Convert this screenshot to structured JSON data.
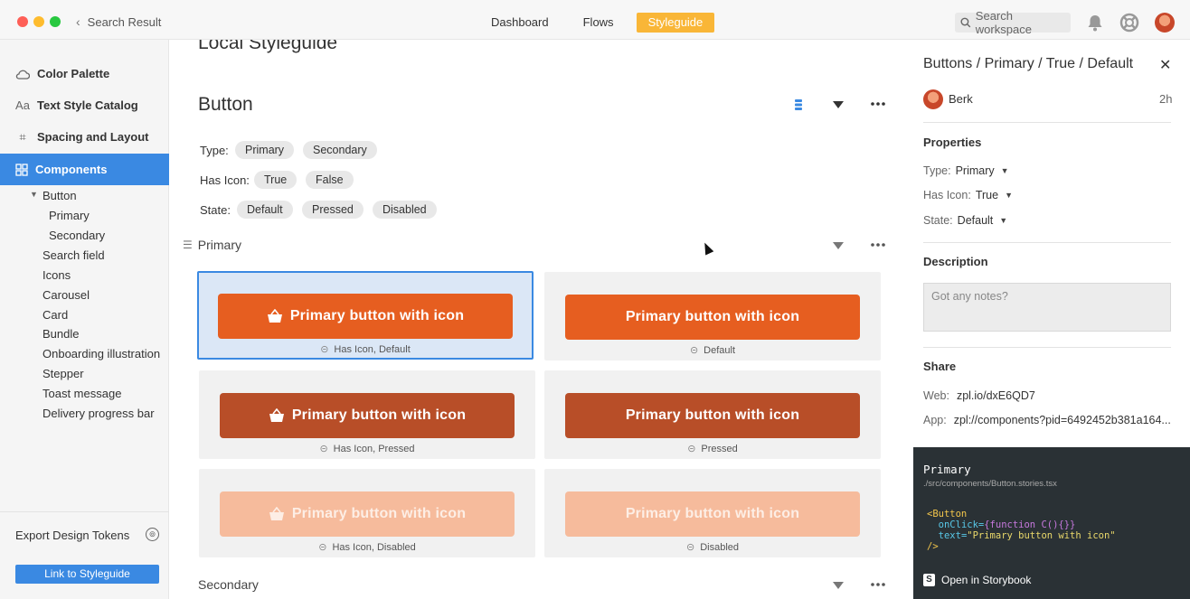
{
  "titlebar": {
    "back_label": "Search Result",
    "nav": [
      "Dashboard",
      "Flows",
      "Styleguide"
    ],
    "active_nav": "Styleguide",
    "search_placeholder": "Search workspace"
  },
  "sidebar": {
    "items": [
      {
        "label": "Color Palette",
        "icon": "cloud-icon"
      },
      {
        "label": "Text Style Catalog",
        "icon": "text-aa-icon"
      },
      {
        "label": "Spacing and Layout",
        "icon": "grid-icon"
      },
      {
        "label": "Components",
        "icon": "components-icon"
      }
    ],
    "active": "Components",
    "tree": {
      "button": "Button",
      "button_children": [
        "Primary",
        "Secondary"
      ],
      "others": [
        "Search field",
        "Icons",
        "Carousel",
        "Card",
        "Bundle",
        "Onboarding illustration",
        "Stepper",
        "Toast message",
        "Delivery progress bar"
      ]
    },
    "export_label": "Export Design Tokens",
    "link_button": "Link to Styleguide"
  },
  "main": {
    "page_title": "Local Styleguide",
    "section_title": "Button",
    "filters": {
      "type_label": "Type:",
      "type_options": [
        "Primary",
        "Secondary"
      ],
      "has_icon_label": "Has Icon:",
      "has_icon_options": [
        "True",
        "False"
      ],
      "state_label": "State:",
      "state_options": [
        "Default",
        "Pressed",
        "Disabled"
      ]
    },
    "group_primary": "Primary",
    "group_secondary": "Secondary",
    "cards": [
      {
        "label": "Primary button with icon",
        "caption": "Has Icon, Default",
        "icon": true,
        "state": "default",
        "selected": true
      },
      {
        "label": "Primary button with icon",
        "caption": "Default",
        "icon": false,
        "state": "default",
        "selected": false
      },
      {
        "label": "Primary button with icon",
        "caption": "Has Icon, Pressed",
        "icon": true,
        "state": "pressed",
        "selected": false
      },
      {
        "label": "Primary button with icon",
        "caption": "Pressed",
        "icon": false,
        "state": "pressed",
        "selected": false
      },
      {
        "label": "Primary button with icon",
        "caption": "Has Icon, Disabled",
        "icon": true,
        "state": "disabled",
        "selected": false
      },
      {
        "label": "Primary button with icon",
        "caption": "Disabled",
        "icon": false,
        "state": "disabled",
        "selected": false
      }
    ]
  },
  "panel": {
    "title": "Buttons / Primary / True / Default",
    "user": "Berk",
    "time": "2h",
    "properties_head": "Properties",
    "props": [
      {
        "label": "Type:",
        "value": "Primary"
      },
      {
        "label": "Has Icon:",
        "value": "True"
      },
      {
        "label": "State:",
        "value": "Default"
      }
    ],
    "description_head": "Description",
    "notes_placeholder": "Got any notes?",
    "share_head": "Share",
    "web_label": "Web:",
    "web_value": "zpl.io/dxE6QD7",
    "app_label": "App:",
    "app_value": "zpl://components?pid=6492452b381a164...",
    "code": {
      "title": "Primary",
      "path": "./src/components/Button.stories.tsx",
      "line1": "<Button",
      "line2_attr": "onClick=",
      "line2_val": "{function C(){}}",
      "line3_attr": "text=",
      "line3_val": "\"Primary button with icon\"",
      "line4": "/>",
      "storybook": "Open in Storybook"
    }
  },
  "colors": {
    "accent_blue": "#3a89e2",
    "styleguide_tab": "#f9b637",
    "button_default": "#e65e20",
    "button_pressed": "#b84e28",
    "button_disabled": "#f6bb9c"
  }
}
